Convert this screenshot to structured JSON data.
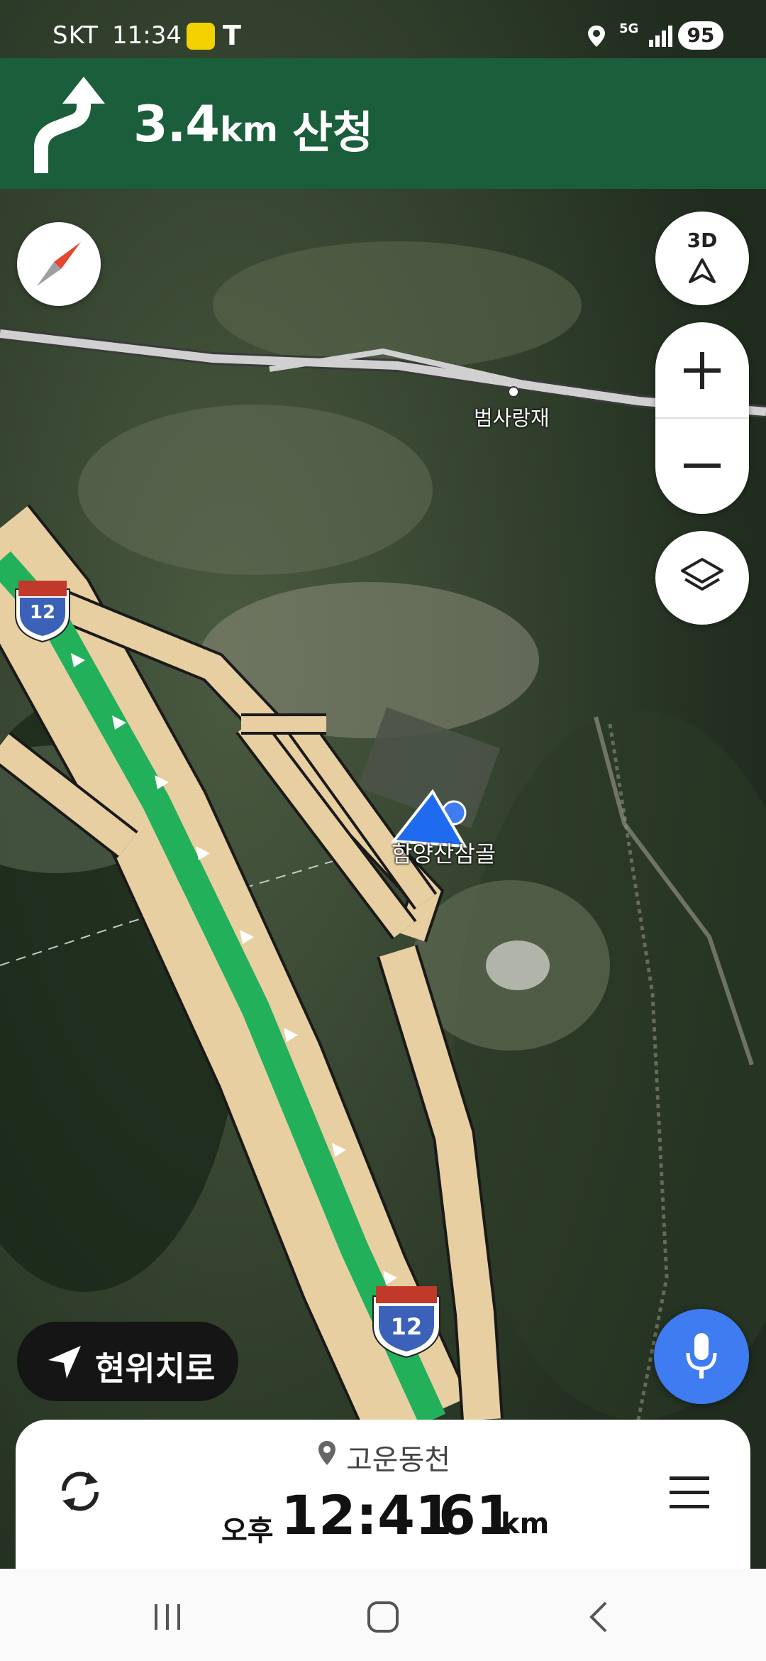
{
  "status_bar": {
    "carrier": "SKT",
    "time": "11:34",
    "network": "5G",
    "battery": "95"
  },
  "navigation": {
    "distance": "3.4",
    "distance_unit": "km",
    "destination": "산청"
  },
  "map": {
    "labels": {
      "pass": "범사랑재",
      "rest_area": "함양산삼골"
    },
    "route_shields": [
      "12",
      "12"
    ]
  },
  "controls": {
    "view_mode": "3D",
    "current_location_label": "현위치로"
  },
  "trip": {
    "destination": "고운동천",
    "arrival_period": "오후",
    "arrival_time": "12:41",
    "remaining_distance": "61",
    "remaining_unit": "km"
  },
  "colors": {
    "banner": "#1b5e3b",
    "route": "#22b05a",
    "road": "#e8cfa2",
    "mic_button": "#3f7cf2"
  }
}
